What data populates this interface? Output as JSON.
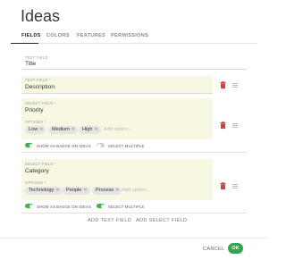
{
  "dialog": {
    "title": "Ideas"
  },
  "tabs": [
    {
      "label": "FIELDS",
      "active": true
    },
    {
      "label": "COLORS",
      "active": false
    },
    {
      "label": "FEATURES",
      "active": false
    },
    {
      "label": "PERMISSIONS",
      "active": false
    }
  ],
  "fields": [
    {
      "type_label": "TEXT FIELD",
      "value": "Title",
      "highlighted": false
    },
    {
      "type_label": "TEXT FIELD *",
      "value": "Description",
      "highlighted": true
    },
    {
      "type_label": "SELECT FIELD *",
      "value": "Priority",
      "options_label": "OPTIONS *",
      "options": [
        "Low",
        "Medium",
        "High"
      ],
      "add_option_placeholder": "Add option...",
      "show_as_badge": {
        "label": "SHOW AS BADGE ON IDEAS",
        "on": true
      },
      "select_multiple": {
        "label": "SELECT MULTIPLE",
        "on": false
      },
      "highlighted": true
    },
    {
      "type_label": "SELECT FIELD *",
      "value": "Category",
      "options_label": "OPTIONS *",
      "options": [
        "Technology",
        "People",
        "Process"
      ],
      "add_option_placeholder": "Add option...",
      "show_as_badge": {
        "label": "SHOW AS BADGE ON IDEAS",
        "on": true
      },
      "select_multiple": {
        "label": "SELECT MULTIPLE",
        "on": true
      },
      "highlighted": true
    }
  ],
  "actions": {
    "add_text_field": "ADD TEXT FIELD",
    "add_select_field": "ADD SELECT FIELD"
  },
  "footer": {
    "cancel": "CANCEL",
    "ok": "OK"
  },
  "colors": {
    "accent_green": "#2fa84f",
    "delete_red": "#e53935",
    "highlight": "#f8f8e2"
  },
  "icons": {
    "delete": "trash-icon",
    "drag": "drag-handle-icon",
    "remove_option": "close-icon"
  }
}
